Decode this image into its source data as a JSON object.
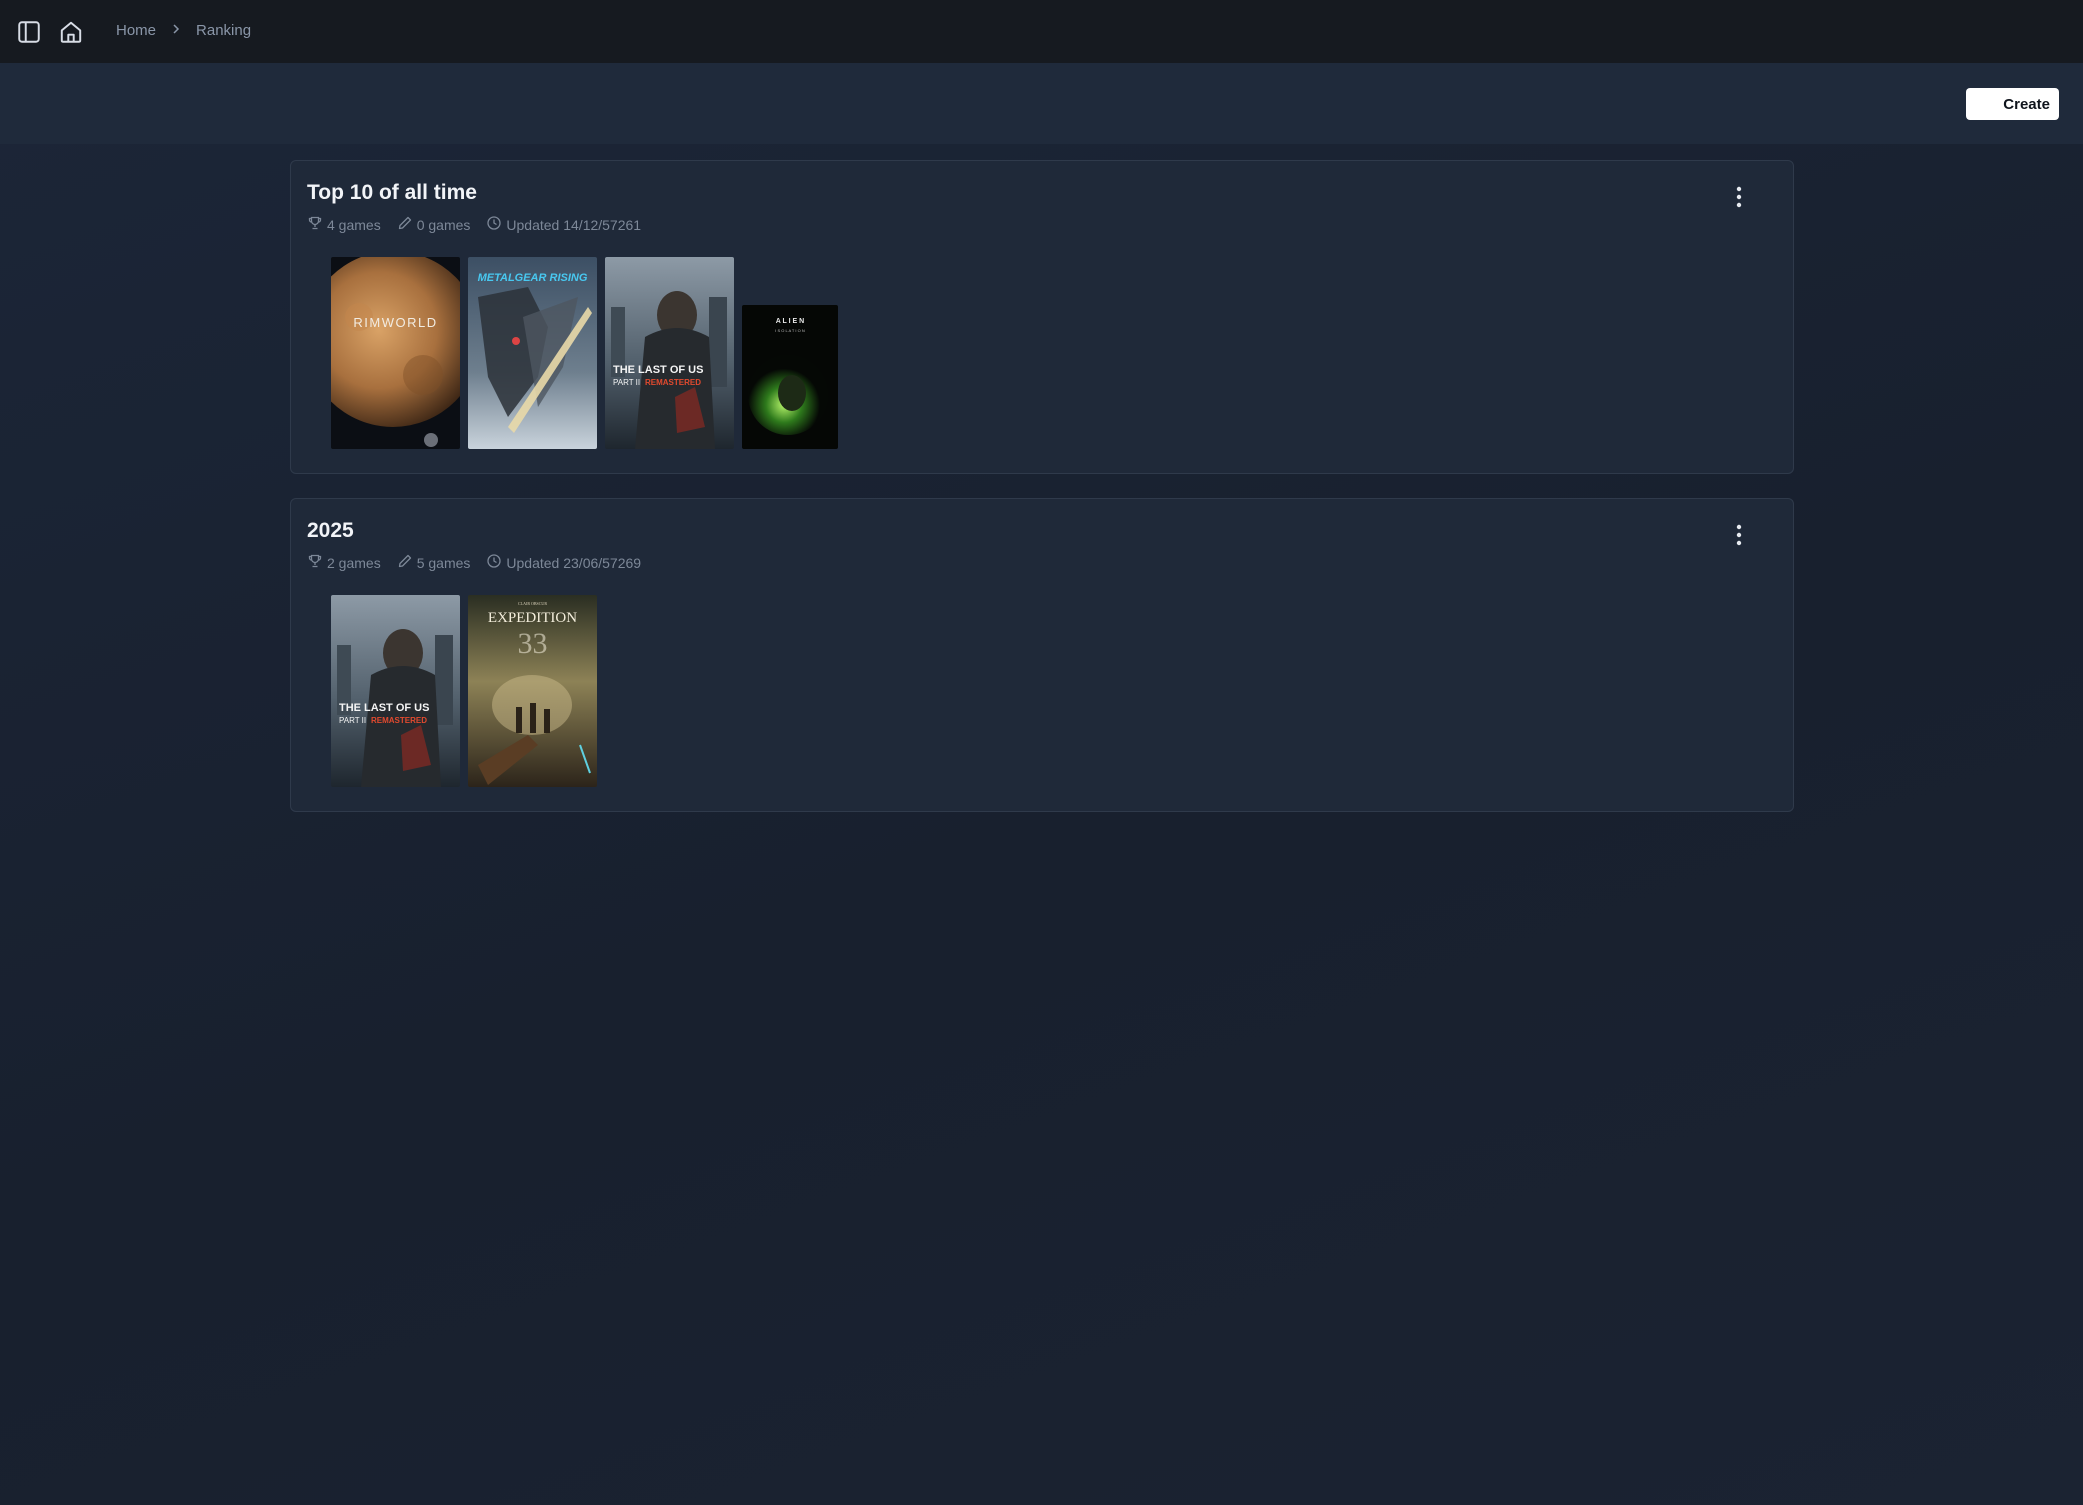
{
  "breadcrumb": {
    "home": "Home",
    "current": "Ranking"
  },
  "toolbar": {
    "create_label": "Create"
  },
  "rankings": [
    {
      "title": "Top 10 of all time",
      "ranked_count": "4 games",
      "edited_count": "0 games",
      "updated": "Updated 14/12/57261",
      "covers": [
        {
          "name": "RimWorld",
          "logo": "RIMWORLD"
        },
        {
          "name": "Metal Gear Rising",
          "logo": "METALGEAR RISING"
        },
        {
          "name": "The Last of Us Part II Remastered",
          "logo_a": "THE LAST OF US",
          "logo_b": "PART II",
          "logo_c": "REMASTERED"
        },
        {
          "name": "Alien Isolation",
          "logo_a": "A L I E N",
          "logo_b": "I S O L A T I O N"
        }
      ]
    },
    {
      "title": "2025",
      "ranked_count": "2 games",
      "edited_count": "5 games",
      "updated": "Updated 23/06/57269",
      "covers": [
        {
          "name": "The Last of Us Part II Remastered",
          "logo_a": "THE LAST OF US",
          "logo_b": "PART II",
          "logo_c": "REMASTERED"
        },
        {
          "name": "Clair Obscur Expedition 33",
          "logo_a": "CLAIR OBSCUR",
          "logo_b": "EXPEDITION",
          "logo_c": "33"
        }
      ]
    }
  ],
  "colors": {
    "topbar": "#161a20",
    "subheader": "#1f2a3b",
    "card": "#1f2939",
    "accent_text": "#8a96a8"
  }
}
